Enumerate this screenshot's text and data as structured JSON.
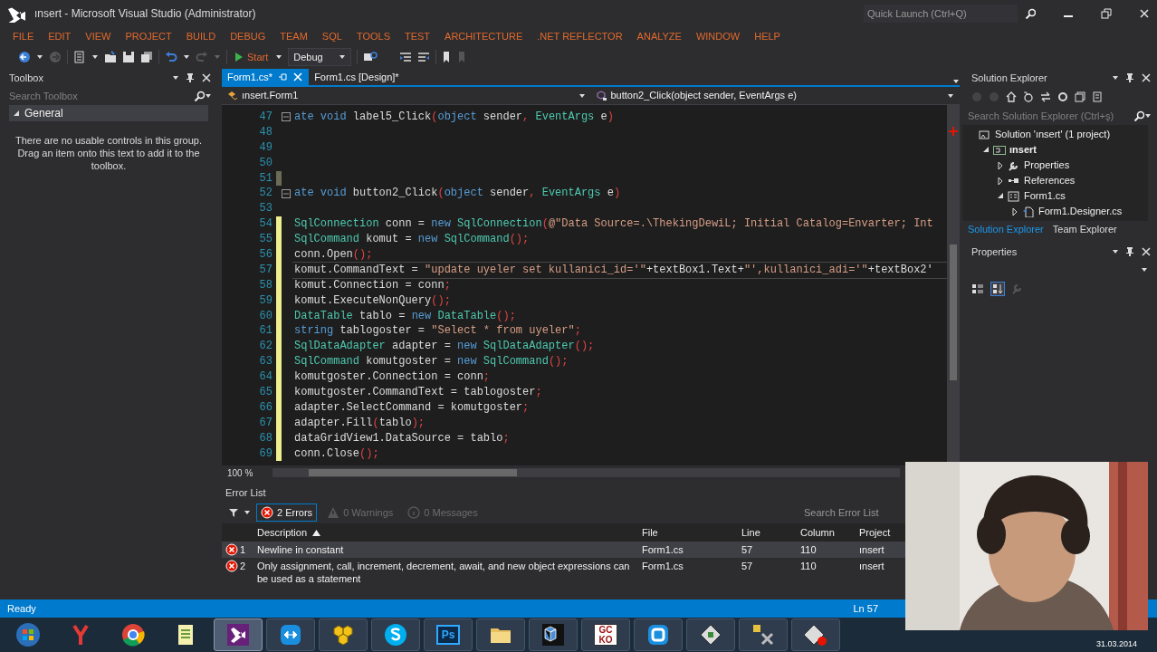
{
  "window": {
    "title": "ınsert - Microsoft Visual Studio (Administrator)",
    "quick_launch": {
      "placeholder": "Quick Launch (Ctrl+Q)"
    }
  },
  "menu": [
    "FILE",
    "EDIT",
    "VIEW",
    "PROJECT",
    "BUILD",
    "DEBUG",
    "TEAM",
    "SQL",
    "TOOLS",
    "TEST",
    "ARCHITECTURE",
    ".NET REFLECTOR",
    "ANALYZE",
    "WINDOW",
    "HELP"
  ],
  "toolbar": {
    "start": "Start",
    "configuration": "Debug"
  },
  "toolbox": {
    "title": "Toolbox",
    "search": {
      "placeholder": "Search Toolbox"
    },
    "group": {
      "label": "General",
      "expanded": true
    },
    "message": "There are no usable controls in this group. Drag an item onto this text to add it to the toolbox."
  },
  "document_tabs": [
    {
      "label": "Form1.cs*",
      "selected": true
    },
    {
      "label": "Form1.cs [Design]*",
      "selected": false
    }
  ],
  "navigation": {
    "type": "ınsert.Form1",
    "member": "button2_Click(object sender, EventArgs e)"
  },
  "code_lines": [
    {
      "number": "47",
      "collapsible": true,
      "segments": [
        {
          "kind": "kw",
          "text": "ate void"
        },
        {
          "kind": "plain",
          "text": " label5_Click"
        },
        {
          "kind": "punct",
          "text": "("
        },
        {
          "kind": "kw",
          "text": "object"
        },
        {
          "kind": "plain",
          "text": " sender"
        },
        {
          "kind": "punct",
          "text": ", "
        },
        {
          "kind": "type",
          "text": "EventArgs"
        },
        {
          "kind": "plain",
          "text": " e"
        },
        {
          "kind": "punct",
          "text": ")"
        }
      ]
    },
    {
      "number": "48"
    },
    {
      "number": "49"
    },
    {
      "number": "50"
    },
    {
      "number": "51",
      "saved_change": true
    },
    {
      "number": "52",
      "collapsible": true,
      "segments": [
        {
          "kind": "kw",
          "text": "ate void"
        },
        {
          "kind": "plain",
          "text": " button2_Click"
        },
        {
          "kind": "punct",
          "text": "("
        },
        {
          "kind": "kw",
          "text": "object"
        },
        {
          "kind": "plain",
          "text": " sender"
        },
        {
          "kind": "punct",
          "text": ", "
        },
        {
          "kind": "type",
          "text": "EventArgs"
        },
        {
          "kind": "plain",
          "text": " e"
        },
        {
          "kind": "punct",
          "text": ")"
        }
      ]
    },
    {
      "number": "53"
    },
    {
      "number": "54",
      "unsaved_change": true,
      "segments": [
        {
          "kind": "type",
          "text": "SqlConnection"
        },
        {
          "kind": "plain",
          "text": " conn = "
        },
        {
          "kind": "kw",
          "text": "new "
        },
        {
          "kind": "type",
          "text": "SqlConnection"
        },
        {
          "kind": "punct",
          "text": "("
        },
        {
          "kind": "str",
          "text": "@\"Data Source=.\\ThekingDewiL; Initial Catalog=Envarter; Int"
        }
      ]
    },
    {
      "number": "55",
      "unsaved_change": true,
      "segments": [
        {
          "kind": "type",
          "text": "SqlCommand"
        },
        {
          "kind": "plain",
          "text": " komut = "
        },
        {
          "kind": "kw",
          "text": "new "
        },
        {
          "kind": "type",
          "text": "SqlCommand"
        },
        {
          "kind": "punct",
          "text": "();"
        }
      ]
    },
    {
      "number": "56",
      "unsaved_change": true,
      "segments": [
        {
          "kind": "plain",
          "text": "conn.Open"
        },
        {
          "kind": "punct",
          "text": "();"
        }
      ]
    },
    {
      "number": "57",
      "unsaved_change": true,
      "current": true,
      "segments": [
        {
          "kind": "plain",
          "text": "komut.CommandText = "
        },
        {
          "kind": "str",
          "text": "\"update uyeler set kullanici_id='\""
        },
        {
          "kind": "plain",
          "text": "+textBox1.Text+"
        },
        {
          "kind": "str",
          "text": "\"',kullanici_adi='\""
        },
        {
          "kind": "plain",
          "text": "+textBox2'"
        }
      ]
    },
    {
      "number": "58",
      "unsaved_change": true,
      "segments": [
        {
          "kind": "plain",
          "text": "komut.Connection = conn"
        },
        {
          "kind": "punct",
          "text": ";"
        }
      ]
    },
    {
      "number": "59",
      "unsaved_change": true,
      "segments": [
        {
          "kind": "plain",
          "text": "komut.ExecuteNonQuery"
        },
        {
          "kind": "punct",
          "text": "();"
        }
      ]
    },
    {
      "number": "60",
      "unsaved_change": true,
      "segments": [
        {
          "kind": "type",
          "text": "DataTable"
        },
        {
          "kind": "plain",
          "text": " tablo = "
        },
        {
          "kind": "kw",
          "text": "new "
        },
        {
          "kind": "type",
          "text": "DataTable"
        },
        {
          "kind": "punct",
          "text": "();"
        }
      ]
    },
    {
      "number": "61",
      "unsaved_change": true,
      "segments": [
        {
          "kind": "kw",
          "text": "string"
        },
        {
          "kind": "plain",
          "text": " tablogoster = "
        },
        {
          "kind": "str",
          "text": "\"Select * from uyeler\""
        },
        {
          "kind": "punct",
          "text": ";"
        }
      ]
    },
    {
      "number": "62",
      "unsaved_change": true,
      "segments": [
        {
          "kind": "type",
          "text": "SqlDataAdapter"
        },
        {
          "kind": "plain",
          "text": " adapter = "
        },
        {
          "kind": "kw",
          "text": "new "
        },
        {
          "kind": "type",
          "text": "SqlDataAdapter"
        },
        {
          "kind": "punct",
          "text": "();"
        }
      ]
    },
    {
      "number": "63",
      "unsaved_change": true,
      "segments": [
        {
          "kind": "type",
          "text": "SqlCommand"
        },
        {
          "kind": "plain",
          "text": " komutgoster = "
        },
        {
          "kind": "kw",
          "text": "new "
        },
        {
          "kind": "type",
          "text": "SqlCommand"
        },
        {
          "kind": "punct",
          "text": "();"
        }
      ]
    },
    {
      "number": "64",
      "unsaved_change": true,
      "segments": [
        {
          "kind": "plain",
          "text": "komutgoster.Connection = conn"
        },
        {
          "kind": "punct",
          "text": ";"
        }
      ]
    },
    {
      "number": "65",
      "unsaved_change": true,
      "segments": [
        {
          "kind": "plain",
          "text": "komutgoster.CommandText = tablogoster"
        },
        {
          "kind": "punct",
          "text": ";"
        }
      ]
    },
    {
      "number": "66",
      "unsaved_change": true,
      "segments": [
        {
          "kind": "plain",
          "text": "adapter.SelectCommand = komutgoster"
        },
        {
          "kind": "punct",
          "text": ";"
        }
      ]
    },
    {
      "number": "67",
      "unsaved_change": true,
      "segments": [
        {
          "kind": "plain",
          "text": "adapter.Fill"
        },
        {
          "kind": "punct",
          "text": "("
        },
        {
          "kind": "plain",
          "text": "tablo"
        },
        {
          "kind": "punct",
          "text": ");"
        }
      ]
    },
    {
      "number": "68",
      "unsaved_change": true,
      "segments": [
        {
          "kind": "plain",
          "text": "dataGridView1.DataSource = tablo"
        },
        {
          "kind": "punct",
          "text": ";"
        }
      ]
    },
    {
      "number": "69",
      "unsaved_change": true,
      "segments": [
        {
          "kind": "plain",
          "text": "conn.Close"
        },
        {
          "kind": "punct",
          "text": "();"
        }
      ]
    }
  ],
  "zoom": "100 %",
  "error_list": {
    "title": "Error List",
    "filters": [
      {
        "kind": "error",
        "label": "2 Errors",
        "selected": true
      },
      {
        "kind": "warning",
        "label": "0 Warnings",
        "selected": false
      },
      {
        "kind": "message",
        "label": "0 Messages",
        "selected": false
      }
    ],
    "search": {
      "placeholder": "Search Error List"
    },
    "columns": [
      {
        "label": "Description",
        "sorted": true
      },
      {
        "label": "File",
        "sorted": false
      },
      {
        "label": "Line",
        "sorted": false
      },
      {
        "label": "Column",
        "sorted": false
      },
      {
        "label": "Project",
        "sorted": false
      }
    ],
    "rows": [
      {
        "number": "1",
        "description": "Newline in constant",
        "file": "Form1.cs",
        "line": "57",
        "column": "110",
        "project": "ınsert",
        "selected": true
      },
      {
        "number": "2",
        "description": "Only assignment, call, increment, decrement, await, and new object expressions can be used as a statement",
        "file": "Form1.cs",
        "line": "57",
        "column": "110",
        "project": "ınsert",
        "selected": false
      }
    ]
  },
  "solution_explorer": {
    "title": "Solution Explorer",
    "search": {
      "placeholder": "Search Solution Explorer (Ctrl+ş)"
    },
    "tree": [
      {
        "kind": "solution",
        "label": "Solution 'ınsert' (1 project)",
        "children": [
          {
            "kind": "project",
            "label": "ınsert",
            "expanded": true,
            "children": [
              {
                "kind": "properties",
                "label": "Properties",
                "expanded": false
              },
              {
                "kind": "references",
                "label": "References",
                "expanded": false
              },
              {
                "kind": "form",
                "label": "Form1.cs",
                "expanded": true,
                "children": [
                  {
                    "kind": "designer",
                    "label": "Form1.Designer.cs",
                    "expanded": false
                  }
                ]
              }
            ]
          }
        ]
      }
    ],
    "tabs": [
      {
        "label": "Solution Explorer",
        "selected": true
      },
      {
        "label": "Team Explorer",
        "selected": false
      }
    ]
  },
  "properties": {
    "title": "Properties"
  },
  "status_bar": {
    "message": "Ready",
    "position": "Ln 57"
  },
  "taskbar": {
    "items": [
      {
        "kind": "start",
        "selected": false
      },
      {
        "kind": "yandex",
        "selected": false
      },
      {
        "kind": "chrome",
        "selected": false
      },
      {
        "kind": "notepad",
        "selected": false
      },
      {
        "kind": "visualstudio",
        "selected": true
      },
      {
        "kind": "teamviewer",
        "selected": false
      },
      {
        "kind": "honeycomb",
        "selected": false
      },
      {
        "kind": "skype",
        "selected": false
      },
      {
        "kind": "photoshop",
        "label": "Ps",
        "selected": false
      },
      {
        "kind": "folder",
        "selected": false
      },
      {
        "kind": "cube",
        "selected": false
      },
      {
        "kind": "gcko",
        "label": "GC KO",
        "selected": false
      },
      {
        "kind": "vm",
        "selected": false
      },
      {
        "kind": "tool",
        "selected": false
      },
      {
        "kind": "builder",
        "selected": false
      },
      {
        "kind": "record",
        "selected": false
      }
    ],
    "date": "31.03.2014"
  },
  "webcam": {
    "kind": "picture"
  }
}
